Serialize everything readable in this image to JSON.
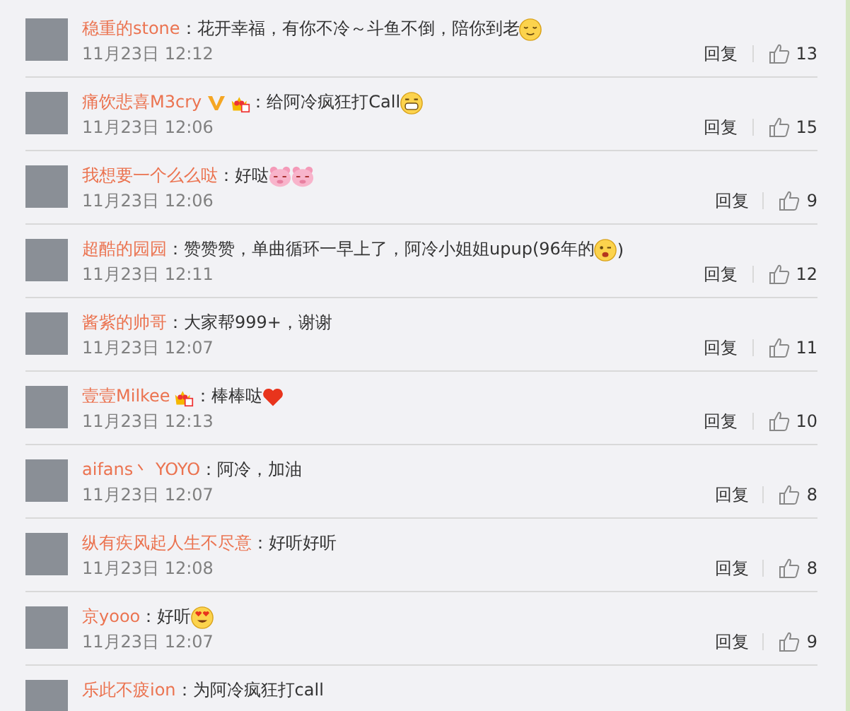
{
  "comments": [
    {
      "name": "稳重的stone",
      "parts": [
        {
          "kind": "text",
          "text": "：花开幸福，有你不冷～斗鱼不倒，陪你到老"
        },
        {
          "kind": "sleepy"
        }
      ],
      "date": "11月23日 12:12",
      "reply": "回复",
      "likes": "13"
    },
    {
      "name": "痛饮悲喜M3cry",
      "badges": [
        {
          "kind": "vip"
        },
        {
          "kind": "crown"
        }
      ],
      "parts": [
        {
          "kind": "text",
          "text": "：给阿冷疯狂打Call"
        },
        {
          "kind": "grin"
        }
      ],
      "date": "11月23日 12:06",
      "reply": "回复",
      "likes": "15"
    },
    {
      "name": "我想要一个么么哒",
      "parts": [
        {
          "kind": "text",
          "text": "：好哒"
        },
        {
          "kind": "pig"
        },
        {
          "kind": "pig"
        }
      ],
      "date": "11月23日 12:06",
      "reply": "回复",
      "likes": "9"
    },
    {
      "name": "超酷的园园",
      "parts": [
        {
          "kind": "text",
          "text": "：赞赞赞，单曲循环一早上了，阿冷小姐姐upup(96年的"
        },
        {
          "kind": "wink"
        },
        {
          "kind": "text",
          "text": ")"
        }
      ],
      "date": "11月23日 12:11",
      "reply": "回复",
      "likes": "12"
    },
    {
      "name": "酱紫的帅哥",
      "parts": [
        {
          "kind": "text",
          "text": "：大家帮999+，谢谢"
        }
      ],
      "date": "11月23日 12:07",
      "reply": "回复",
      "likes": "11"
    },
    {
      "name": "壹壹Milkee",
      "badges": [
        {
          "kind": "crown"
        }
      ],
      "parts": [
        {
          "kind": "text",
          "text": "：棒棒哒"
        },
        {
          "kind": "heart"
        }
      ],
      "date": "11月23日 12:13",
      "reply": "回复",
      "likes": "10"
    },
    {
      "name": "aifans丶 YOYO",
      "parts": [
        {
          "kind": "text",
          "text": "：阿冷，加油"
        }
      ],
      "date": "11月23日 12:07",
      "reply": "回复",
      "likes": "8"
    },
    {
      "name": "纵有疾风起人生不尽意",
      "parts": [
        {
          "kind": "text",
          "text": "：好听好听"
        }
      ],
      "date": "11月23日 12:08",
      "reply": "回复",
      "likes": "8"
    },
    {
      "name": "京yooo",
      "parts": [
        {
          "kind": "text",
          "text": "：好听"
        },
        {
          "kind": "heart-eyes"
        }
      ],
      "date": "11月23日 12:07",
      "reply": "回复",
      "likes": "9"
    },
    {
      "name": "乐此不疲ion",
      "parts": [
        {
          "kind": "text",
          "text": "：为阿冷疯狂打call"
        }
      ]
    }
  ]
}
